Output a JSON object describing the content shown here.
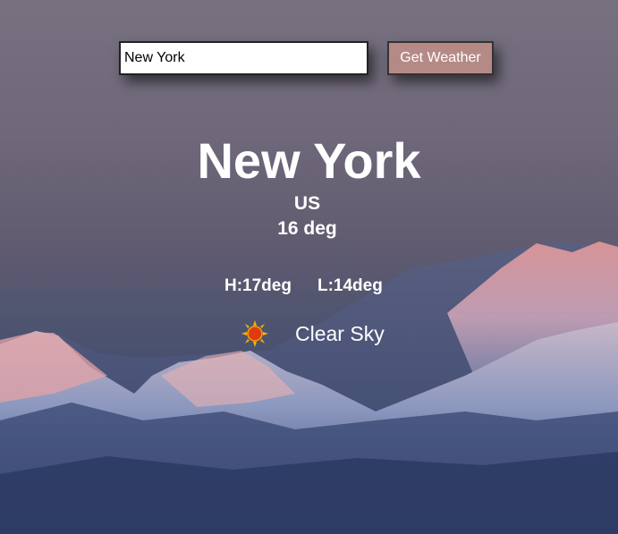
{
  "search": {
    "value": "New York",
    "button_label": "Get Weather"
  },
  "weather": {
    "city": "New York",
    "country": "US",
    "temperature": "16 deg",
    "high": "H:17deg",
    "low": "L:14deg",
    "condition": "Clear Sky",
    "icon": "sun-icon"
  },
  "colors": {
    "button_bg": "#b58a86",
    "text": "#ffffff"
  }
}
